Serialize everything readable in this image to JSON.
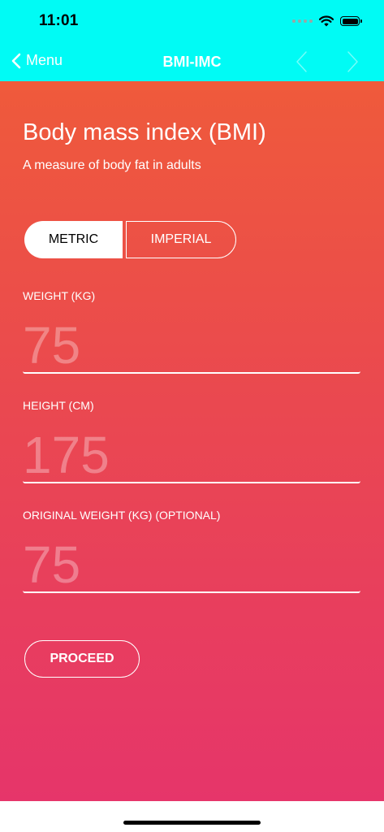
{
  "status_bar": {
    "time": "11:01"
  },
  "nav": {
    "back_label": "Menu",
    "title": "BMI-IMC"
  },
  "header": {
    "title": "Body mass index (BMI)",
    "subtitle": "A measure of body fat in adults"
  },
  "units": {
    "metric_label": "METRIC",
    "imperial_label": "IMPERIAL",
    "selected": "METRIC"
  },
  "fields": {
    "weight": {
      "label": "WEIGHT (KG)",
      "placeholder": "75"
    },
    "height": {
      "label": "HEIGHT (CM)",
      "placeholder": "175"
    },
    "original_weight": {
      "label": "ORIGINAL WEIGHT (KG) (OPTIONAL)",
      "placeholder": "75"
    }
  },
  "actions": {
    "proceed_label": "PROCEED"
  },
  "colors": {
    "nav_background": "#00fbf5",
    "gradient_top": "#ef5a3b",
    "gradient_bottom": "#e6356a"
  }
}
